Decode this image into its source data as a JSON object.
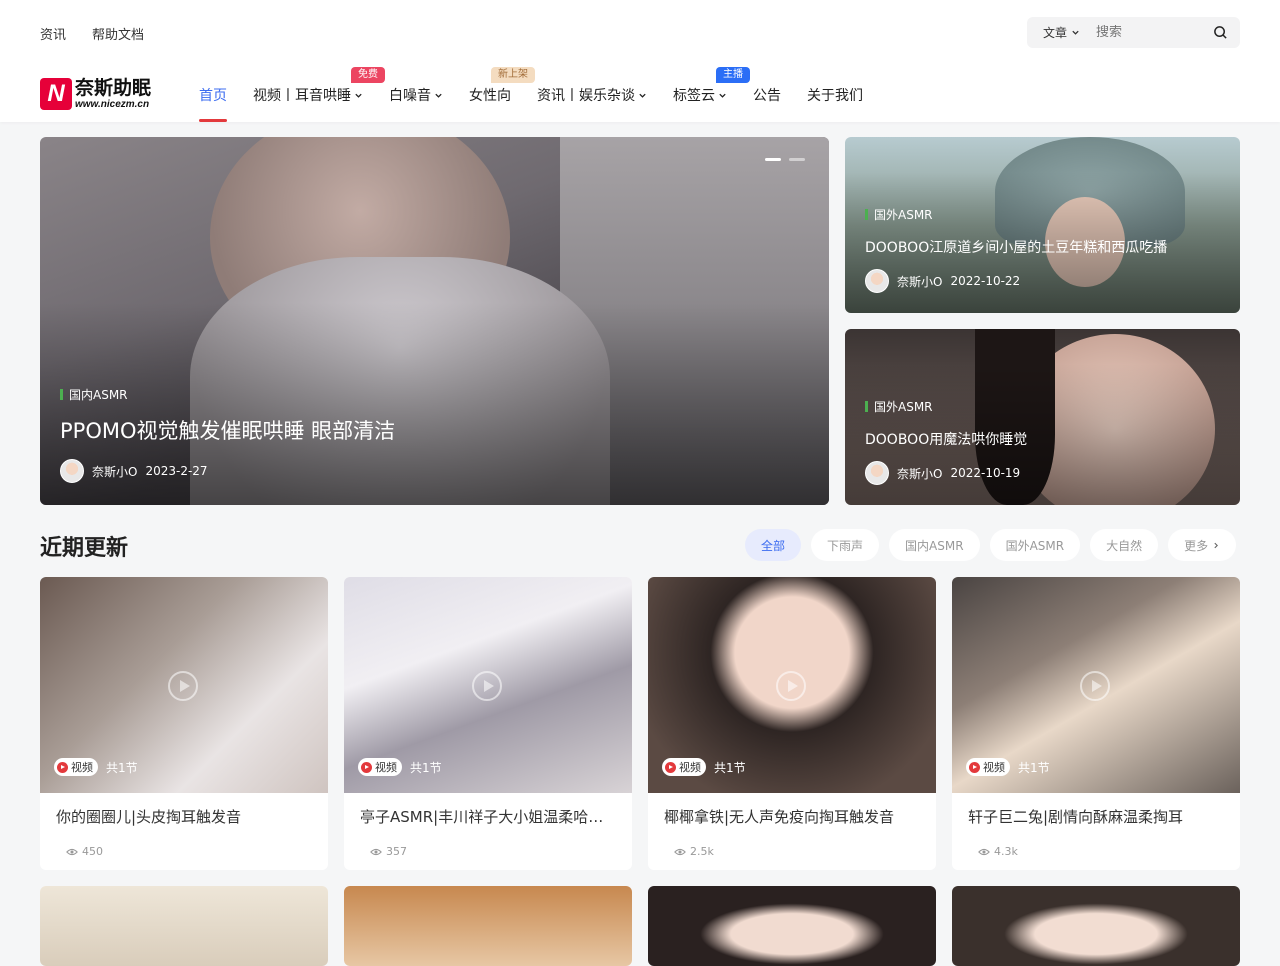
{
  "top_links": [
    "资讯",
    "帮助文档"
  ],
  "search": {
    "scope": "文章",
    "placeholder": "搜索"
  },
  "logo": {
    "mark": "N",
    "name": "奈斯助眠",
    "url": "www.nicezm.cn"
  },
  "nav": [
    {
      "label": "首页",
      "active": true,
      "dropdown": false,
      "badge": ""
    },
    {
      "label": "视频丨耳音哄睡",
      "active": false,
      "dropdown": true,
      "badge": "免费"
    },
    {
      "label": "白噪音",
      "active": false,
      "dropdown": true,
      "badge": ""
    },
    {
      "label": "女性向",
      "active": false,
      "dropdown": false,
      "badge": "新上架"
    },
    {
      "label": "资讯丨娱乐杂谈",
      "active": false,
      "dropdown": true,
      "badge": ""
    },
    {
      "label": "标签云",
      "active": false,
      "dropdown": true,
      "badge": "主播"
    },
    {
      "label": "公告",
      "active": false,
      "dropdown": false,
      "badge": ""
    },
    {
      "label": "关于我们",
      "active": false,
      "dropdown": false,
      "badge": ""
    }
  ],
  "hero": {
    "category": "国内ASMR",
    "title": "PPOMO视觉触发催眠哄睡 眼部清洁",
    "author": "奈斯小O",
    "date": "2023-2-27"
  },
  "side_posts": [
    {
      "category": "国外ASMR",
      "title": "DOOBOO江原道乡间小屋的土豆年糕和西瓜吃播",
      "author": "奈斯小O",
      "date": "2022-10-22"
    },
    {
      "category": "国外ASMR",
      "title": "DOOBOO用魔法哄你睡觉",
      "author": "奈斯小O",
      "date": "2022-10-19"
    }
  ],
  "section": {
    "title": "近期更新",
    "tabs": [
      "全部",
      "下雨声",
      "国内ASMR",
      "国外ASMR",
      "大自然",
      "更多"
    ]
  },
  "cards": [
    {
      "tag": "视频",
      "sections": "共1节",
      "title": "你的圈圈儿|头皮掏耳触发音",
      "views": "450"
    },
    {
      "tag": "视频",
      "sections": "共1节",
      "title": "亭子ASMR|丰川祥子大小姐温柔哈气~小狗舔耳 软萌萌的轻语舔耳",
      "views": "357"
    },
    {
      "tag": "视频",
      "sections": "共1节",
      "title": "椰椰拿铁|无人声免疫向掏耳触发音",
      "views": "2.5k"
    },
    {
      "tag": "视频",
      "sections": "共1节",
      "title": "轩子巨二兔|剧情向酥麻温柔掏耳",
      "views": "4.3k"
    }
  ],
  "colors": {
    "accent": "#3c6cf0",
    "active_underline": "#e3393c",
    "logo": "#e60039"
  }
}
